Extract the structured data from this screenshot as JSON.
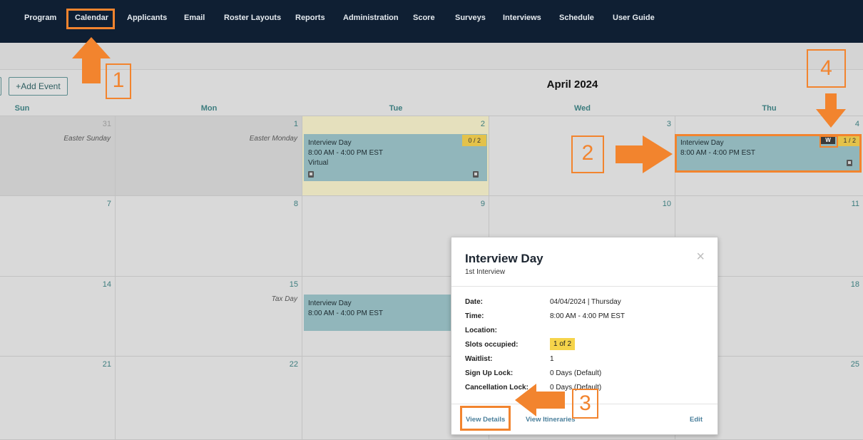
{
  "nav": {
    "items": [
      "Program",
      "Calendar",
      "Applicants",
      "Email",
      "Roster Layouts",
      "Reports",
      "Administration",
      "Score",
      "Surveys",
      "Interviews",
      "Schedule",
      "User Guide"
    ]
  },
  "toolbar": {
    "add_event_label": "+Add Event"
  },
  "calendar": {
    "month_title": "April 2024",
    "days_of_week": [
      "Sun",
      "Mon",
      "Tue",
      "Wed",
      "Thu"
    ],
    "week1": {
      "d31": "31",
      "d1": "1",
      "d2": "2",
      "d3": "3",
      "d4": "4"
    },
    "week2": {
      "d7": "7",
      "d8": "8",
      "d9": "9",
      "d10": "10",
      "d11": "11"
    },
    "week3": {
      "d14": "14",
      "d15": "15",
      "d18": "18"
    },
    "week4": {
      "d21": "21",
      "d22": "22",
      "d25": "25"
    },
    "holidays": {
      "easter_sunday": "Easter Sunday",
      "easter_monday": "Easter Monday",
      "tax_day": "Tax Day"
    },
    "events": [
      {
        "title": "Interview Day",
        "time": "8:00 AM - 4:00 PM EST",
        "location": "Virtual",
        "slots": "0 / 2"
      },
      {
        "title": "Interview Day",
        "time": "8:00 AM - 4:00 PM EST",
        "waitlist": "W",
        "slots": "1 / 2"
      },
      {
        "title": "Interview Day",
        "time": "8:00 AM - 4:00 PM EST"
      }
    ]
  },
  "popup": {
    "title": "Interview Day",
    "subtitle": "1st Interview",
    "close": "×",
    "rows": [
      {
        "label": "Date:",
        "value": "04/04/2024 | Thursday"
      },
      {
        "label": "Time:",
        "value": "8:00 AM - 4:00 PM EST"
      },
      {
        "label": "Location:",
        "value": ""
      },
      {
        "label": "Slots occupied:",
        "value": "1 of 2"
      },
      {
        "label": "Waitlist:",
        "value": "1"
      },
      {
        "label": "Sign Up Lock:",
        "value": "0 Days (Default)"
      },
      {
        "label": "Cancellation Lock:",
        "value": "0 Days (Default)"
      }
    ],
    "links": {
      "view_details": "View Details",
      "view_itineraries": "View Itineraries",
      "edit": "Edit"
    }
  },
  "annotations": {
    "n1": "1",
    "n2": "2",
    "n3": "3",
    "n4": "4"
  },
  "colors": {
    "annotation": "#f2842e",
    "nav_bg": "#0f1f33",
    "event_bg": "#91b6bb",
    "slot_badge": "#e3c24a"
  }
}
